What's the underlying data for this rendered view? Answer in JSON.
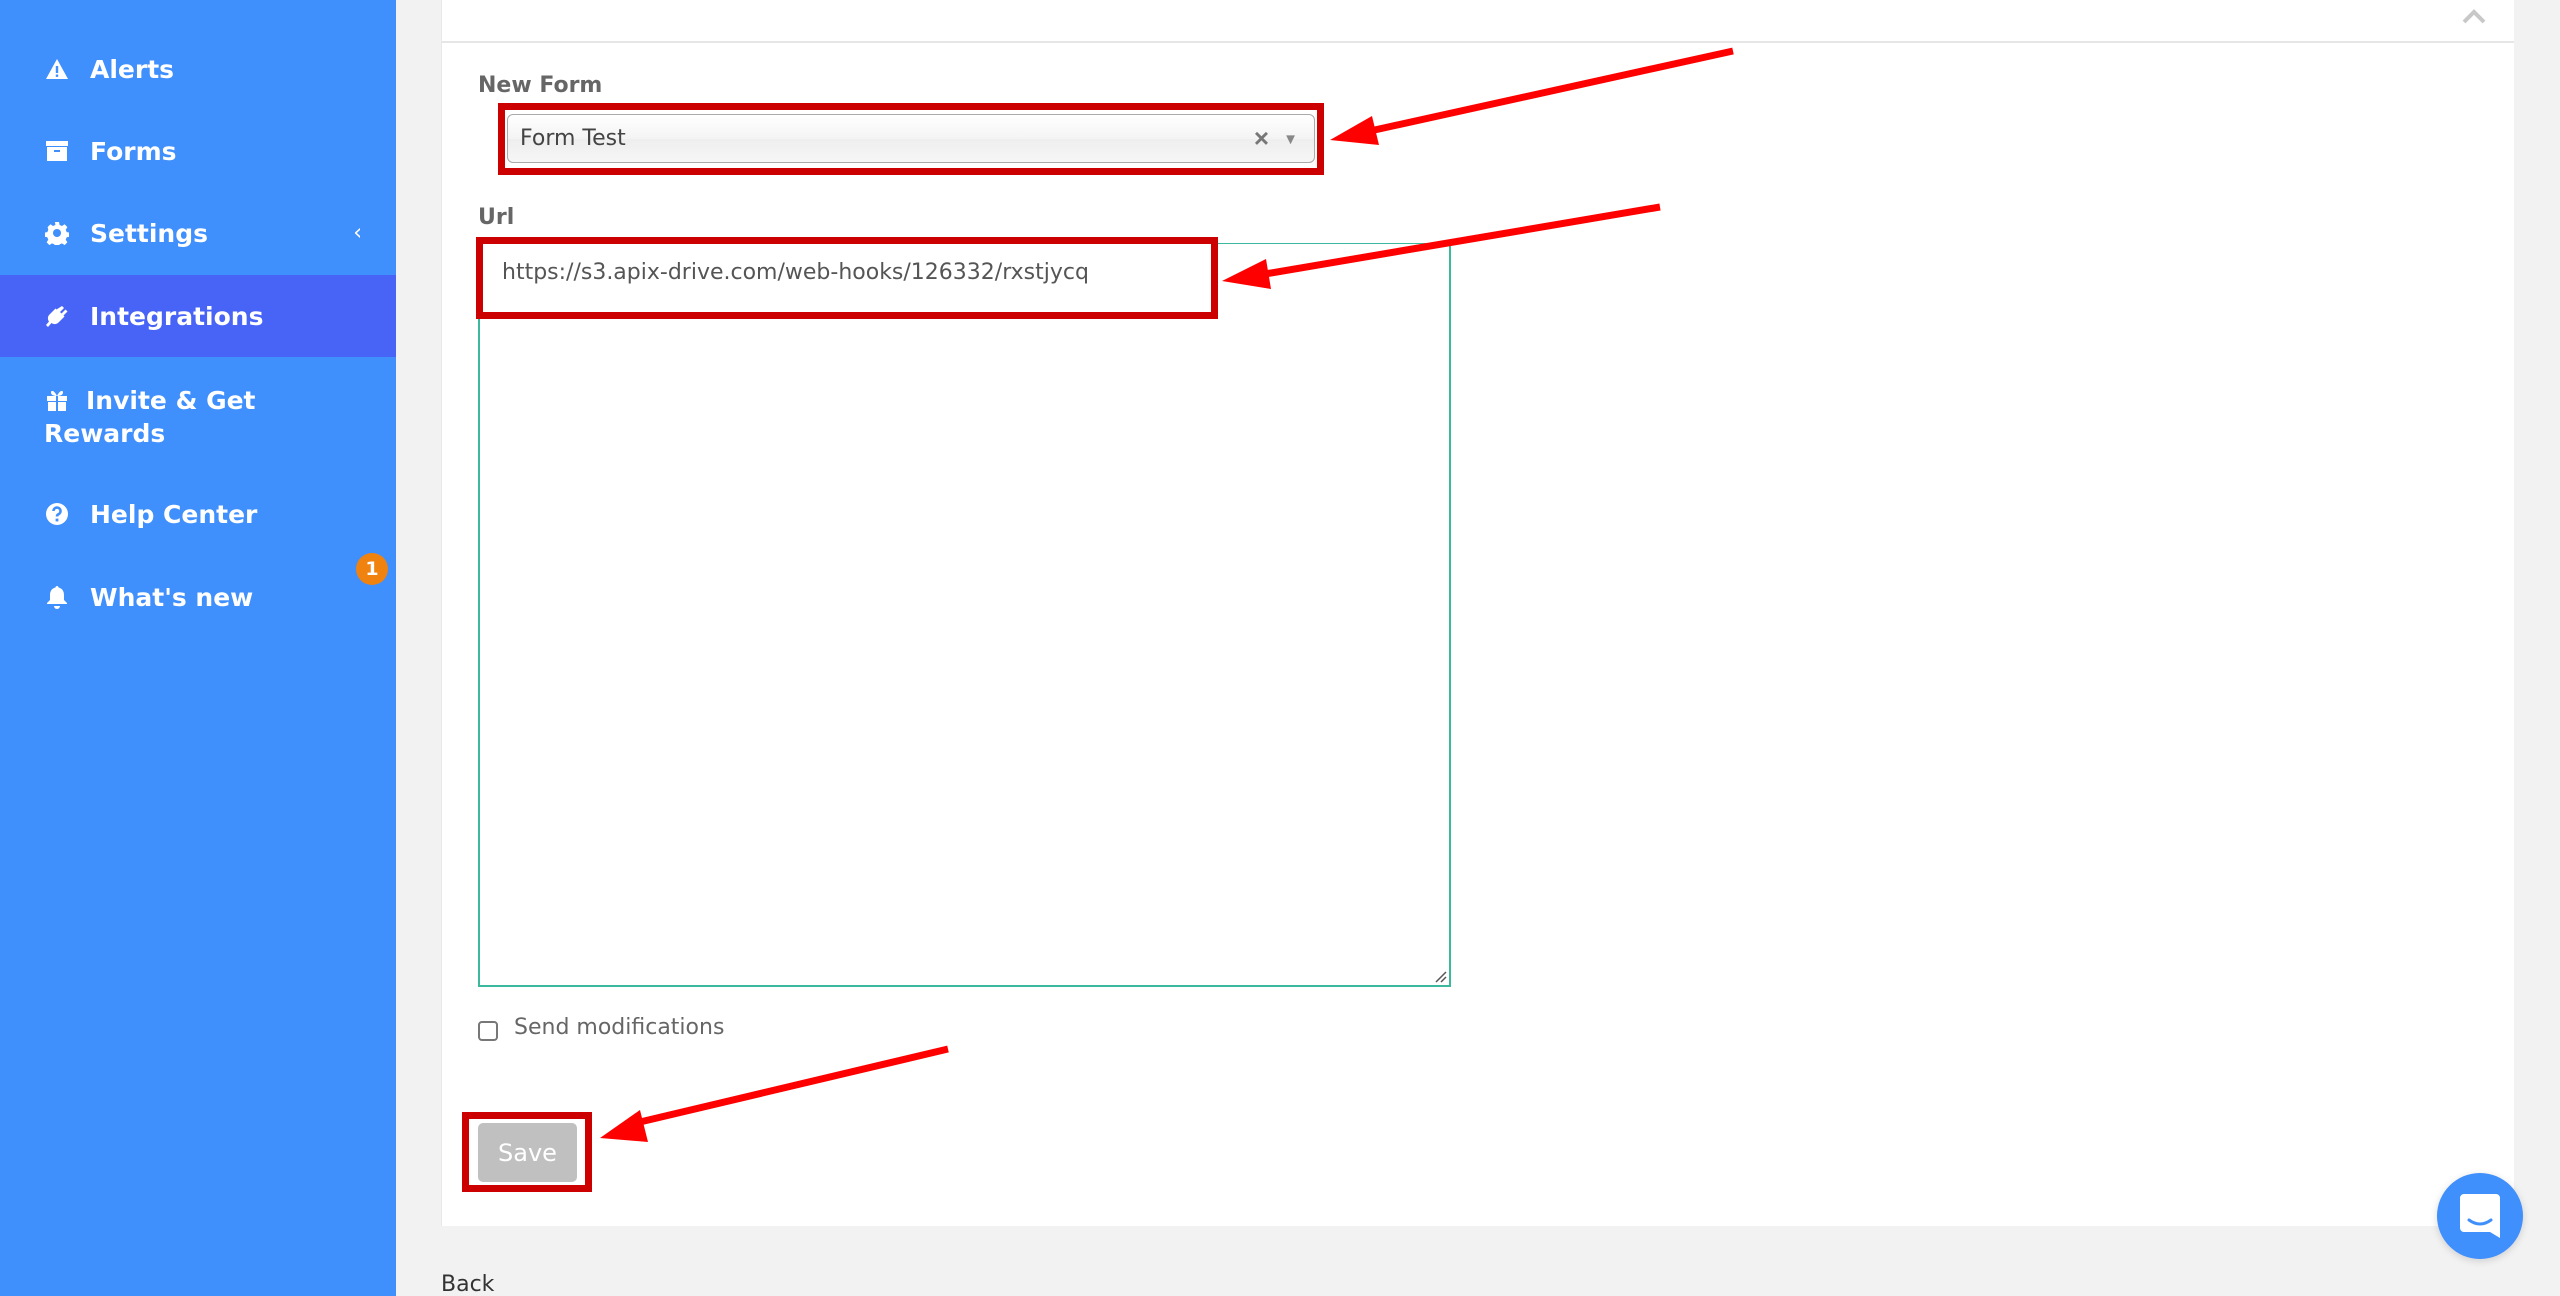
{
  "sidebar": {
    "items": [
      {
        "label": "Alerts",
        "icon": "warning-icon"
      },
      {
        "label": "Forms",
        "icon": "archive-icon"
      },
      {
        "label": "Settings",
        "icon": "gear-icon",
        "chevron": "‹"
      },
      {
        "label": "Integrations",
        "icon": "plug-icon",
        "active": true
      },
      {
        "label": "Invite & Get Rewards",
        "icon": "gift-icon"
      },
      {
        "label": "Help Center",
        "icon": "question-circle-icon"
      },
      {
        "label": "What's new",
        "icon": "bell-icon",
        "badge": "1"
      }
    ]
  },
  "form": {
    "new_form_label": "New Form",
    "new_form_value": "Form Test",
    "clear_symbol": "×",
    "dropdown_symbol": "▼",
    "url_label": "Url",
    "url_value": "https://s3.apix-drive.com/web-hooks/126332/rxstjycq",
    "send_modifications_label": "Send modifications",
    "send_modifications_checked": false,
    "save_label": "Save"
  },
  "footer": {
    "back_label": "Back"
  },
  "colors": {
    "sidebar_bg": "#3f8ffc",
    "sidebar_active_bg": "#4864f6",
    "badge": "#f0820f",
    "textarea_border": "#3cb89c",
    "annotation_red": "#cc0000",
    "arrow_red": "#ff0000",
    "save_disabled": "#c0c0c0"
  }
}
